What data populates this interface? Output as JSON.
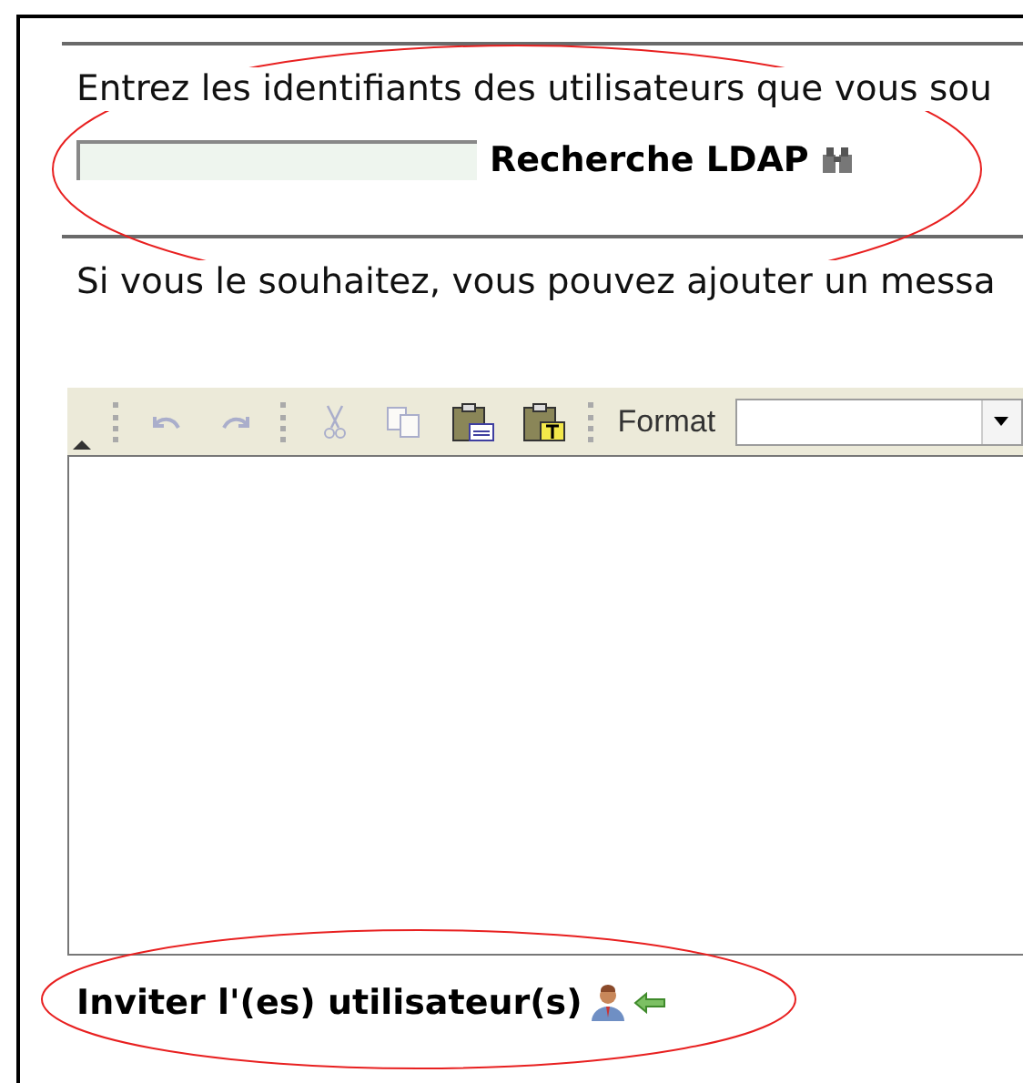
{
  "instructions": "Entrez les identifiants des utilisateurs que vous sou",
  "search": {
    "button": "Recherche LDAP"
  },
  "message_hint": "Si vous le souhaitez, vous pouvez ajouter un messa",
  "toolbar": {
    "buttons": [
      {
        "kind": "undo",
        "disabled": true
      },
      {
        "kind": "redo",
        "disabled": true
      },
      {
        "kind": "separator"
      },
      {
        "kind": "cut",
        "disabled": true
      },
      {
        "kind": "copy",
        "disabled": true
      },
      {
        "kind": "paste",
        "disabled": false
      },
      {
        "kind": "paste-text",
        "disabled": false
      },
      {
        "kind": "separator"
      }
    ],
    "format_label": "Format"
  },
  "invite_button": "Inviter l'(es) utilisateur(s)"
}
